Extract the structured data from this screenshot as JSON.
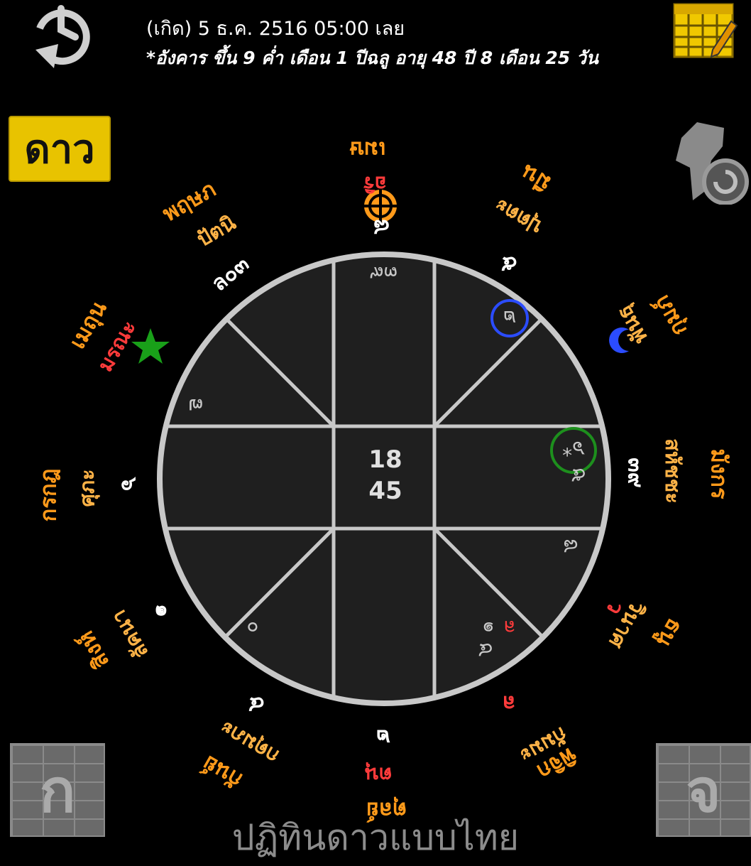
{
  "header": {
    "birth_line": "(เกิด) 5 ธ.ค. 2516 05:00 เลย",
    "lunar_line": "*อังคาร ขึ้น 9 ค่ำ เดือน 1 ปีฉลู อายุ 48 ปี 8 เดือน 25 วัน"
  },
  "buttons": {
    "star_label": "ดาว",
    "prev_label": "ก",
    "next_label": "จ"
  },
  "footer_title": "ปฏิทินดาวแบบไทย",
  "signs": {
    "aries": "เมษ",
    "pisces": "มีน",
    "aquarius": "กุมภ์",
    "capricorn": "มังกร",
    "sagittarius": "ธนู",
    "scorpio": "พิจิก",
    "libra": "ตุลย์",
    "virgo": "กันย์",
    "leo": "สิงห์",
    "cancer": "กรกฎ",
    "gemini": "เมถุน",
    "taurus": "พฤษภ"
  },
  "roles": {
    "ari": "อริ",
    "puttra": "ปุตตะ",
    "phanthu": "พันธุ",
    "sahatcha": "สหัชชะ",
    "kadumpha": "กดุมภะ",
    "tanu": "ตนุ",
    "patni": "ปัตนิ",
    "marana": "มรณะ",
    "subha": "ศุภะ",
    "lakkana": "ลัคนา",
    "kammakamma": "กัมมะ",
    "wina": "วินาศ",
    "kadumpha2": "กดุมภะ"
  },
  "outer_positions": {
    "top": "๘",
    "top_right": "๕",
    "right": "๓๙",
    "left": "๖",
    "top_left": "ล๐๓",
    "bottom_left": "๑",
    "bottom_left2": "๔",
    "bottom": "๒",
    "bottom_right_l": "ล",
    "right_w": "ว"
  },
  "cells": {
    "top_mid": "๓๙",
    "top_right_tri": "๒",
    "left_upper": "๗",
    "right_mid_a": "๖*",
    "right_mid_b": "๕",
    "right_lower": "๘",
    "bottom_left_tri": "๐",
    "bottom_right_a": "๑",
    "bottom_right_l": "ล",
    "bottom_right_b": "๔"
  },
  "center": {
    "line1": "18",
    "line2": "45"
  },
  "icons": {
    "history": "history-clock-icon",
    "calendar": "calendar-edit-icon",
    "refresh": "map-refresh-icon"
  },
  "colors": {
    "sign": "#ff9a1a",
    "role_orange": "#ffb347",
    "role_red": "#ff3b3b",
    "accent_yellow": "#e8c300",
    "chart_bg": "#1e1e1e",
    "chart_line": "#c8c8c8"
  }
}
